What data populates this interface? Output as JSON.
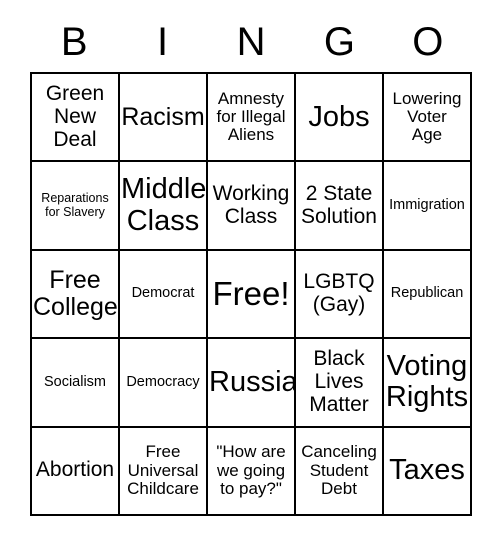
{
  "card": {
    "title": "BINGO",
    "header_letters": [
      "B",
      "I",
      "N",
      "G",
      "O"
    ],
    "colors": {
      "background": "#ffffff",
      "grid_line": "#000000",
      "text": "#000000"
    },
    "rows": [
      [
        {
          "text": "Green\nNew\nDeal",
          "size": "lg"
        },
        {
          "text": "Racism",
          "size": "xl"
        },
        {
          "text": "Amnesty\nfor Illegal\nAliens",
          "size": "md"
        },
        {
          "text": "Jobs",
          "size": "xxl"
        },
        {
          "text": "Lowering\nVoter\nAge",
          "size": "md"
        }
      ],
      [
        {
          "text": "Reparations\nfor Slavery",
          "size": "xs"
        },
        {
          "text": "Middle\nClass",
          "size": "xxl"
        },
        {
          "text": "Working\nClass",
          "size": "lg"
        },
        {
          "text": "2 State\nSolution",
          "size": "lg"
        },
        {
          "text": "Immigration",
          "size": "sm"
        }
      ],
      [
        {
          "text": "Free\nCollege",
          "size": "xl"
        },
        {
          "text": "Democrat",
          "size": "sm"
        },
        {
          "text": "Free!",
          "size": "free"
        },
        {
          "text": "LGBTQ\n(Gay)",
          "size": "lg"
        },
        {
          "text": "Republican",
          "size": "sm"
        }
      ],
      [
        {
          "text": "Socialism",
          "size": "sm"
        },
        {
          "text": "Democracy",
          "size": "sm"
        },
        {
          "text": "Russia",
          "size": "xxl"
        },
        {
          "text": "Black\nLives\nMatter",
          "size": "lg"
        },
        {
          "text": "Voting\nRights",
          "size": "xxl"
        }
      ],
      [
        {
          "text": "Abortion",
          "size": "lg"
        },
        {
          "text": "Free\nUniversal\nChildcare",
          "size": "md"
        },
        {
          "text": "\"How are\nwe going\nto pay?\"",
          "size": "md"
        },
        {
          "text": "Canceling\nStudent\nDebt",
          "size": "md"
        },
        {
          "text": "Taxes",
          "size": "xxl"
        }
      ]
    ]
  }
}
